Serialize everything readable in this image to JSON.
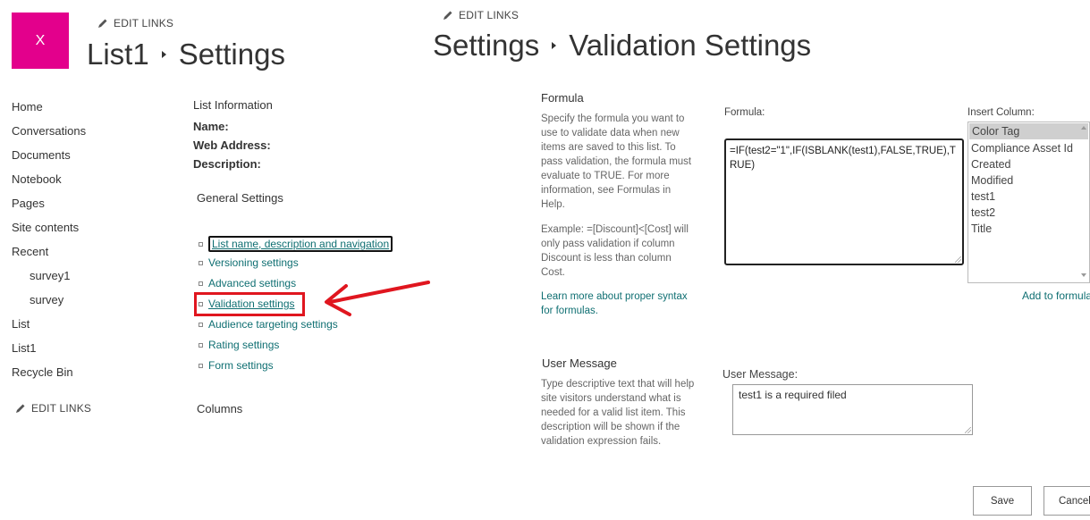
{
  "site": {
    "logo_letter": "X"
  },
  "edit_links": {
    "label": "EDIT LINKS"
  },
  "header_left": {
    "title": "List1",
    "subtitle": "Settings"
  },
  "header_right": {
    "title": "Settings",
    "subtitle": "Validation Settings"
  },
  "left_nav": {
    "items": [
      "Home",
      "Conversations",
      "Documents",
      "Notebook",
      "Pages",
      "Site contents",
      "Recent"
    ],
    "recent_items": [
      "survey1",
      "survey"
    ],
    "bottom_items": [
      "List",
      "List1",
      "Recycle Bin"
    ]
  },
  "list_info": {
    "heading": "List Information",
    "name_label": "Name:",
    "web_address_label": "Web Address:",
    "description_label": "Description:"
  },
  "general_settings": {
    "heading": "General Settings",
    "links": [
      "List name, description and navigation",
      "Versioning settings",
      "Advanced settings",
      "Validation settings",
      "Audience targeting settings",
      "Rating settings",
      "Form settings"
    ]
  },
  "columns": {
    "heading": "Columns"
  },
  "formula_section": {
    "heading": "Formula",
    "description": "Specify the formula you want to use to validate data when new items are saved to this list. To pass validation, the formula must evaluate to TRUE. For more information, see Formulas in Help.",
    "example": "Example: =[Discount]<[Cost] will only pass validation if column Discount is less than column Cost.",
    "learn_more": "Learn more about proper syntax for formulas.",
    "formula_label": "Formula:",
    "formula_value": "=IF(test2=\"1\",IF(ISBLANK(test1),FALSE,TRUE),TRUE)",
    "insert_column_label": "Insert Column:",
    "columns": [
      "Color Tag",
      "Compliance Asset Id",
      "Created",
      "Modified",
      "test1",
      "test2",
      "Title"
    ],
    "selected_column": "Color Tag",
    "add_to_formula": "Add to formula"
  },
  "user_message_section": {
    "heading": "User Message",
    "description": "Type descriptive text that will help site visitors understand what is needed for a valid list item. This description will be shown if the validation expression fails.",
    "field_label": "User Message:",
    "field_value": "test1 is a required filed"
  },
  "buttons": {
    "save": "Save",
    "cancel": "Cancel"
  },
  "colors": {
    "brand": "#e3008c",
    "link": "#0f6f72",
    "annotation": "#e0161f"
  }
}
